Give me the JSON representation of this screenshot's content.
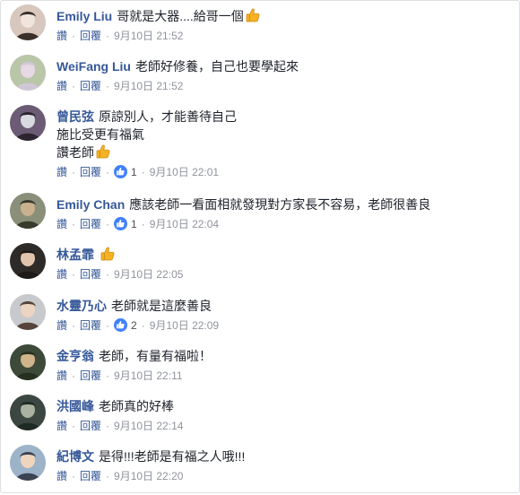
{
  "comments": [
    {
      "author": "Emily Liu",
      "lines": [
        "哥就是大器....給哥一個"
      ],
      "thumb_after_line": 0,
      "like_label": "讚",
      "reply_label": "回覆",
      "likes": "",
      "time": "9月10日 21:52"
    },
    {
      "author": "WeiFang Liu",
      "lines": [
        "老師好修養，自己也要學起來"
      ],
      "thumb_after_line": -1,
      "like_label": "讚",
      "reply_label": "回覆",
      "likes": "",
      "time": "9月10日 21:52"
    },
    {
      "author": "曾民弦",
      "lines": [
        "原諒別人，才能善待自己",
        "施比受更有福氣",
        "讚老師"
      ],
      "thumb_after_line": 2,
      "like_label": "讚",
      "reply_label": "回覆",
      "likes": "1",
      "time": "9月10日 22:01"
    },
    {
      "author": "Emily Chan",
      "lines": [
        "應該老師一看面相就發現對方家長不容易，老師很善良"
      ],
      "thumb_after_line": -1,
      "like_label": "讚",
      "reply_label": "回覆",
      "likes": "1",
      "time": "9月10日 22:04"
    },
    {
      "author": "林孟霏",
      "lines": [
        ""
      ],
      "thumb_after_line": 0,
      "like_label": "讚",
      "reply_label": "回覆",
      "likes": "",
      "time": "9月10日 22:05"
    },
    {
      "author": "水靈乃心",
      "lines": [
        "老師就是這麼善良"
      ],
      "thumb_after_line": -1,
      "like_label": "讚",
      "reply_label": "回覆",
      "likes": "2",
      "time": "9月10日 22:09"
    },
    {
      "author": "金亨翁",
      "lines": [
        "老師，有量有福啦！"
      ],
      "thumb_after_line": -1,
      "like_label": "讚",
      "reply_label": "回覆",
      "likes": "",
      "time": "9月10日 22:11"
    },
    {
      "author": "洪國峰",
      "lines": [
        "老師真的好棒"
      ],
      "thumb_after_line": -1,
      "like_label": "讚",
      "reply_label": "回覆",
      "likes": "",
      "time": "9月10日 22:14"
    },
    {
      "author": "紀博文",
      "lines": [
        "是得!!!老師是有福之人哦!!!"
      ],
      "thumb_after_line": -1,
      "like_label": "讚",
      "reply_label": "回覆",
      "likes": "",
      "time": "9月10日 22:20"
    }
  ],
  "colors": {
    "author_link": "#365899",
    "action_link": "#365899",
    "meta_gray": "#90949c",
    "like_badge": "#4080ff",
    "thumb_emoji": "#f7b125"
  },
  "icons": {
    "thumb": "thumbs-up-emoji-icon",
    "like_badge": "like-reaction-icon"
  }
}
